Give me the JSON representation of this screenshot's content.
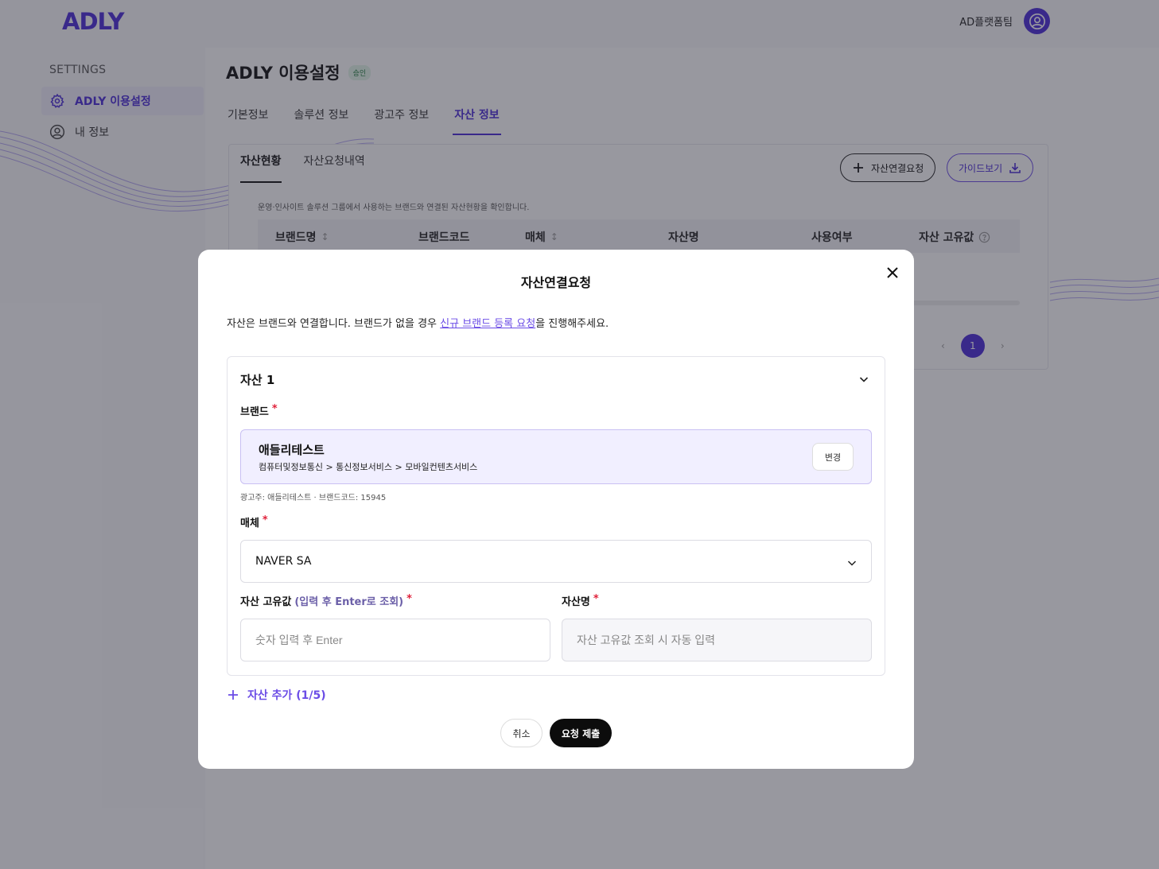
{
  "header": {
    "logo": "ADLY",
    "user_name": "AD플랫폼팀"
  },
  "sidebar": {
    "heading": "SETTINGS",
    "items": [
      {
        "label": "ADLY 이용설정",
        "icon": "gear-icon",
        "active": true
      },
      {
        "label": "내 정보",
        "icon": "user-circle-icon",
        "active": false
      }
    ]
  },
  "page": {
    "title": "ADLY 이용설정",
    "badge": "승인",
    "tabs": [
      "기본정보",
      "솔루션 정보",
      "광고주 정보",
      "자산 정보"
    ],
    "active_tab": "자산 정보"
  },
  "asset_card": {
    "sub_tabs": [
      "자산현황",
      "자산요청내역"
    ],
    "active_sub_tab": "자산현황",
    "asset_request_button": "자산연결요청",
    "guide_button": "가이드보기",
    "description": "운영·인사이트 솔루션 그룹에서 사용하는 브랜드와 연결된 자산현황을 확인합니다.",
    "columns": [
      "브랜드명",
      "브랜드코드",
      "매체",
      "자산명",
      "사용여부",
      "자산 고유값"
    ],
    "current_page": "1"
  },
  "modal": {
    "title": "자산연결요청",
    "intro_before": "자산은 브랜드와 연결합니다. 브랜드가 없을 경우 ",
    "intro_link": "신규 브랜드 등록 요청",
    "intro_after": "을 진행해주세요.",
    "asset_title": "자산 1",
    "brand_label": "브랜드",
    "brand_name": "애들리테스트",
    "brand_path": "컴퓨터및정보통신 > 통신정보서비스 > 모바일컨텐츠서비스",
    "change_button": "변경",
    "brand_meta": "광고주: 애들리테스트 · 브랜드코드: 15945",
    "media_label": "매체",
    "media_value": "NAVER SA",
    "asset_id_label": "자산 고유값",
    "asset_id_hint": "(입력 후 Enter로 조회)",
    "asset_id_placeholder": "숫자 입력 후 Enter",
    "asset_name_label": "자산명",
    "asset_name_placeholder": "자산 고유값 조회 시 자동 입력",
    "required_mark": "*",
    "add_asset": "자산 추가 (1/5)",
    "cancel_button": "취소",
    "submit_button": "요청 제출"
  },
  "colors": {
    "brand": "#4a2bd6",
    "accent": "#6b4ce6",
    "required": "#e0223b"
  }
}
